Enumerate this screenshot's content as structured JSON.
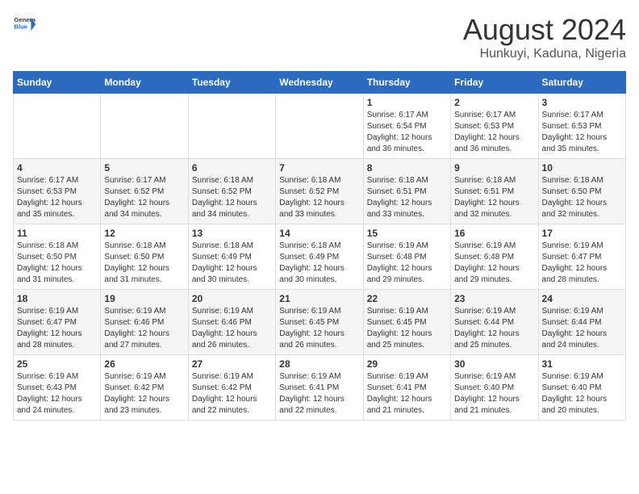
{
  "header": {
    "logo_general": "General",
    "logo_blue": "Blue",
    "month_year": "August 2024",
    "location": "Hunkuyi, Kaduna, Nigeria"
  },
  "days_of_week": [
    "Sunday",
    "Monday",
    "Tuesday",
    "Wednesday",
    "Thursday",
    "Friday",
    "Saturday"
  ],
  "weeks": [
    [
      {
        "day": "",
        "info": ""
      },
      {
        "day": "",
        "info": ""
      },
      {
        "day": "",
        "info": ""
      },
      {
        "day": "",
        "info": ""
      },
      {
        "day": "1",
        "info": "Sunrise: 6:17 AM\nSunset: 6:54 PM\nDaylight: 12 hours and 36 minutes."
      },
      {
        "day": "2",
        "info": "Sunrise: 6:17 AM\nSunset: 6:53 PM\nDaylight: 12 hours and 36 minutes."
      },
      {
        "day": "3",
        "info": "Sunrise: 6:17 AM\nSunset: 6:53 PM\nDaylight: 12 hours and 35 minutes."
      }
    ],
    [
      {
        "day": "4",
        "info": "Sunrise: 6:17 AM\nSunset: 6:53 PM\nDaylight: 12 hours and 35 minutes."
      },
      {
        "day": "5",
        "info": "Sunrise: 6:17 AM\nSunset: 6:52 PM\nDaylight: 12 hours and 34 minutes."
      },
      {
        "day": "6",
        "info": "Sunrise: 6:18 AM\nSunset: 6:52 PM\nDaylight: 12 hours and 34 minutes."
      },
      {
        "day": "7",
        "info": "Sunrise: 6:18 AM\nSunset: 6:52 PM\nDaylight: 12 hours and 33 minutes."
      },
      {
        "day": "8",
        "info": "Sunrise: 6:18 AM\nSunset: 6:51 PM\nDaylight: 12 hours and 33 minutes."
      },
      {
        "day": "9",
        "info": "Sunrise: 6:18 AM\nSunset: 6:51 PM\nDaylight: 12 hours and 32 minutes."
      },
      {
        "day": "10",
        "info": "Sunrise: 6:18 AM\nSunset: 6:50 PM\nDaylight: 12 hours and 32 minutes."
      }
    ],
    [
      {
        "day": "11",
        "info": "Sunrise: 6:18 AM\nSunset: 6:50 PM\nDaylight: 12 hours and 31 minutes."
      },
      {
        "day": "12",
        "info": "Sunrise: 6:18 AM\nSunset: 6:50 PM\nDaylight: 12 hours and 31 minutes."
      },
      {
        "day": "13",
        "info": "Sunrise: 6:18 AM\nSunset: 6:49 PM\nDaylight: 12 hours and 30 minutes."
      },
      {
        "day": "14",
        "info": "Sunrise: 6:18 AM\nSunset: 6:49 PM\nDaylight: 12 hours and 30 minutes."
      },
      {
        "day": "15",
        "info": "Sunrise: 6:19 AM\nSunset: 6:48 PM\nDaylight: 12 hours and 29 minutes."
      },
      {
        "day": "16",
        "info": "Sunrise: 6:19 AM\nSunset: 6:48 PM\nDaylight: 12 hours and 29 minutes."
      },
      {
        "day": "17",
        "info": "Sunrise: 6:19 AM\nSunset: 6:47 PM\nDaylight: 12 hours and 28 minutes."
      }
    ],
    [
      {
        "day": "18",
        "info": "Sunrise: 6:19 AM\nSunset: 6:47 PM\nDaylight: 12 hours and 28 minutes."
      },
      {
        "day": "19",
        "info": "Sunrise: 6:19 AM\nSunset: 6:46 PM\nDaylight: 12 hours and 27 minutes."
      },
      {
        "day": "20",
        "info": "Sunrise: 6:19 AM\nSunset: 6:46 PM\nDaylight: 12 hours and 26 minutes."
      },
      {
        "day": "21",
        "info": "Sunrise: 6:19 AM\nSunset: 6:45 PM\nDaylight: 12 hours and 26 minutes."
      },
      {
        "day": "22",
        "info": "Sunrise: 6:19 AM\nSunset: 6:45 PM\nDaylight: 12 hours and 25 minutes."
      },
      {
        "day": "23",
        "info": "Sunrise: 6:19 AM\nSunset: 6:44 PM\nDaylight: 12 hours and 25 minutes."
      },
      {
        "day": "24",
        "info": "Sunrise: 6:19 AM\nSunset: 6:44 PM\nDaylight: 12 hours and 24 minutes."
      }
    ],
    [
      {
        "day": "25",
        "info": "Sunrise: 6:19 AM\nSunset: 6:43 PM\nDaylight: 12 hours and 24 minutes."
      },
      {
        "day": "26",
        "info": "Sunrise: 6:19 AM\nSunset: 6:42 PM\nDaylight: 12 hours and 23 minutes."
      },
      {
        "day": "27",
        "info": "Sunrise: 6:19 AM\nSunset: 6:42 PM\nDaylight: 12 hours and 22 minutes."
      },
      {
        "day": "28",
        "info": "Sunrise: 6:19 AM\nSunset: 6:41 PM\nDaylight: 12 hours and 22 minutes."
      },
      {
        "day": "29",
        "info": "Sunrise: 6:19 AM\nSunset: 6:41 PM\nDaylight: 12 hours and 21 minutes."
      },
      {
        "day": "30",
        "info": "Sunrise: 6:19 AM\nSunset: 6:40 PM\nDaylight: 12 hours and 21 minutes."
      },
      {
        "day": "31",
        "info": "Sunrise: 6:19 AM\nSunset: 6:40 PM\nDaylight: 12 hours and 20 minutes."
      }
    ]
  ]
}
